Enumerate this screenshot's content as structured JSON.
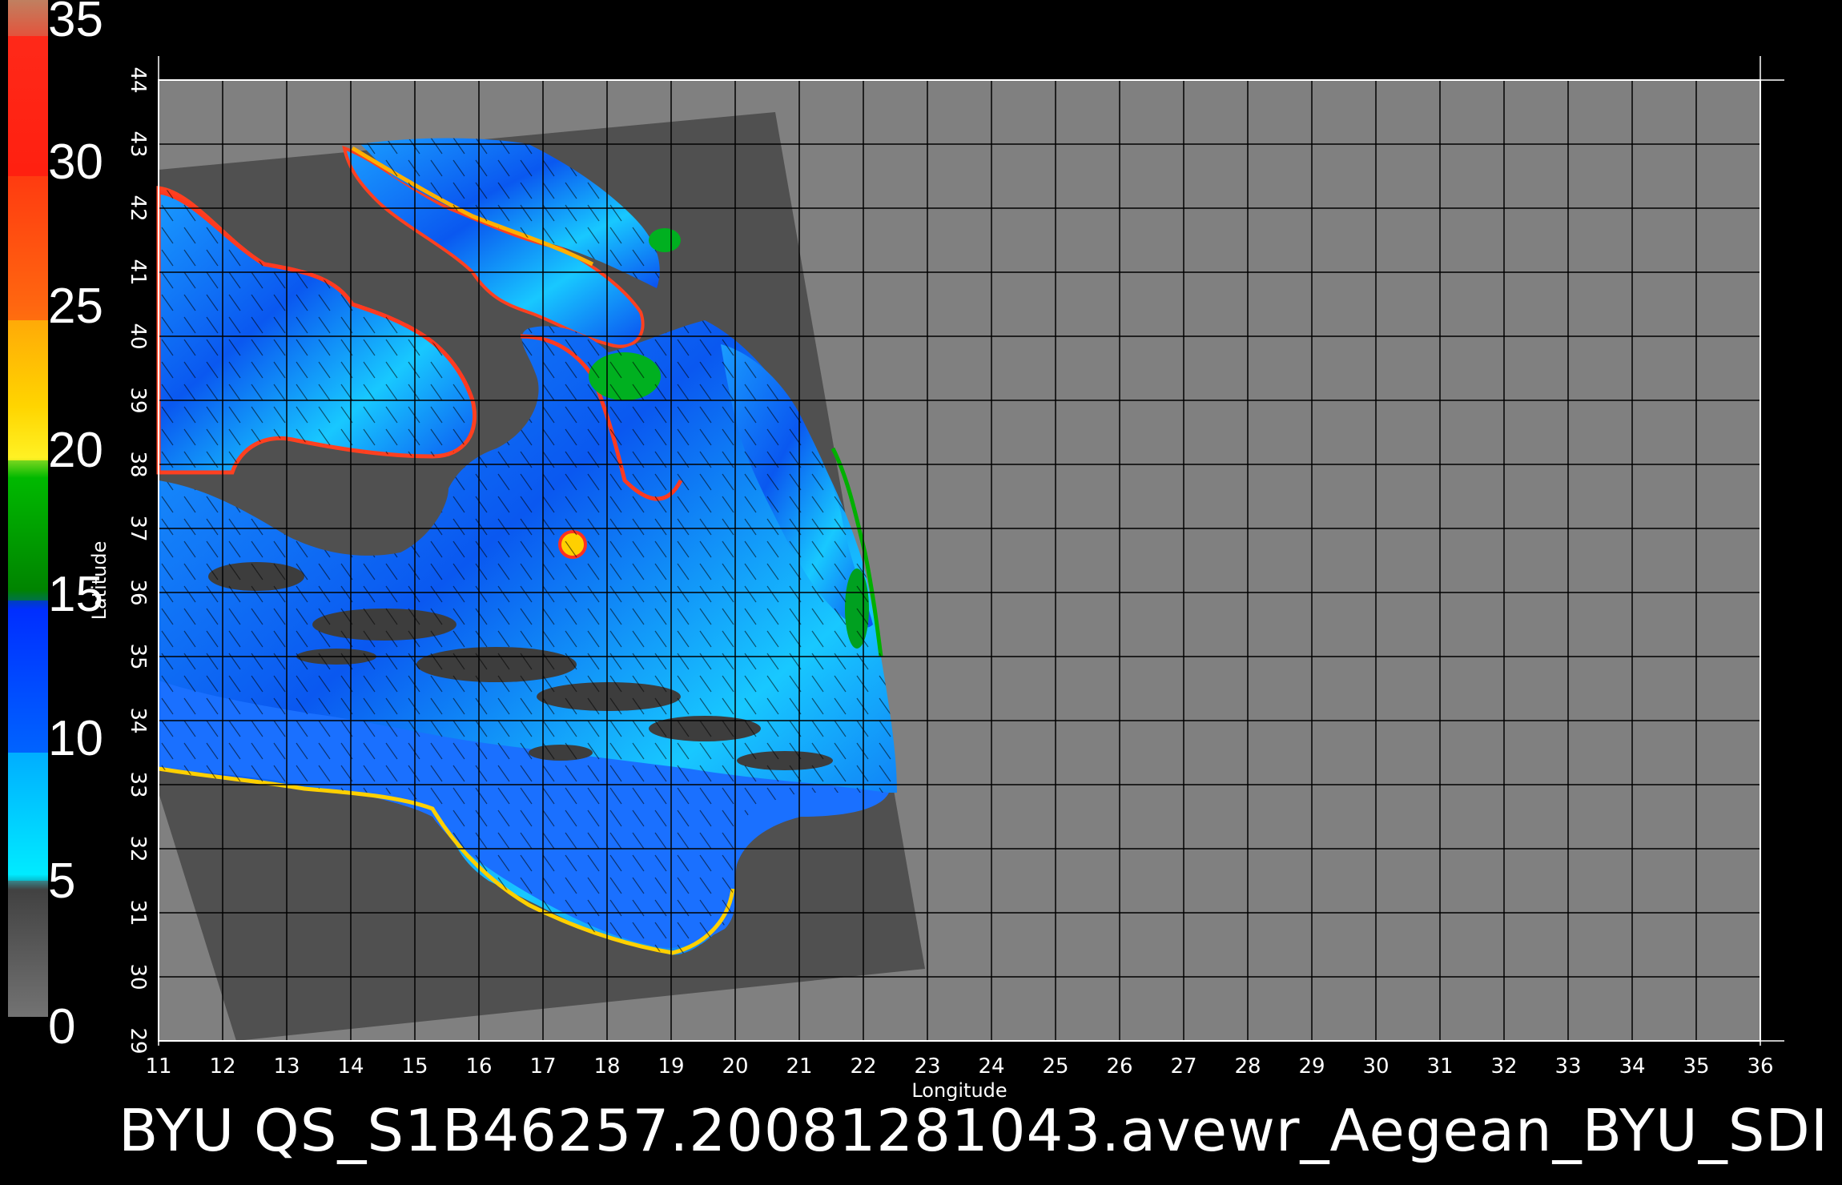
{
  "colorbar": {
    "labels": [
      "35",
      "30",
      "25",
      "20",
      "15",
      "10",
      "5",
      "0"
    ],
    "colors": {
      "0_5": "#6a6a6a",
      "5_10": "#00e5ff",
      "10_15": "#0040ff",
      "15_20": "#00b000",
      "20_25": "#ffe000",
      "25_30": "#ff5a10",
      "30_35": "#ff2010"
    }
  },
  "axes": {
    "xlabel": "Longitude",
    "ylabel": "Latitude",
    "x_ticks": [
      "11",
      "12",
      "13",
      "14",
      "15",
      "16",
      "17",
      "18",
      "19",
      "20",
      "21",
      "22",
      "23",
      "24",
      "25",
      "26",
      "27",
      "28",
      "29",
      "30",
      "31",
      "32",
      "33",
      "34",
      "35",
      "36"
    ],
    "y_ticks": [
      "29",
      "30",
      "31",
      "32",
      "33",
      "34",
      "35",
      "36",
      "37",
      "38",
      "39",
      "40",
      "41",
      "42",
      "43",
      "44"
    ],
    "xlim": [
      11,
      36
    ],
    "ylim": [
      29,
      44
    ]
  },
  "title": "BYU  QS_S1B46257.20081281043.avewr_Aegean_BYU_SDI",
  "colors": {
    "background": "#000000",
    "plot_bg": "#808080",
    "swath": "#505050",
    "land": "#505050"
  }
}
